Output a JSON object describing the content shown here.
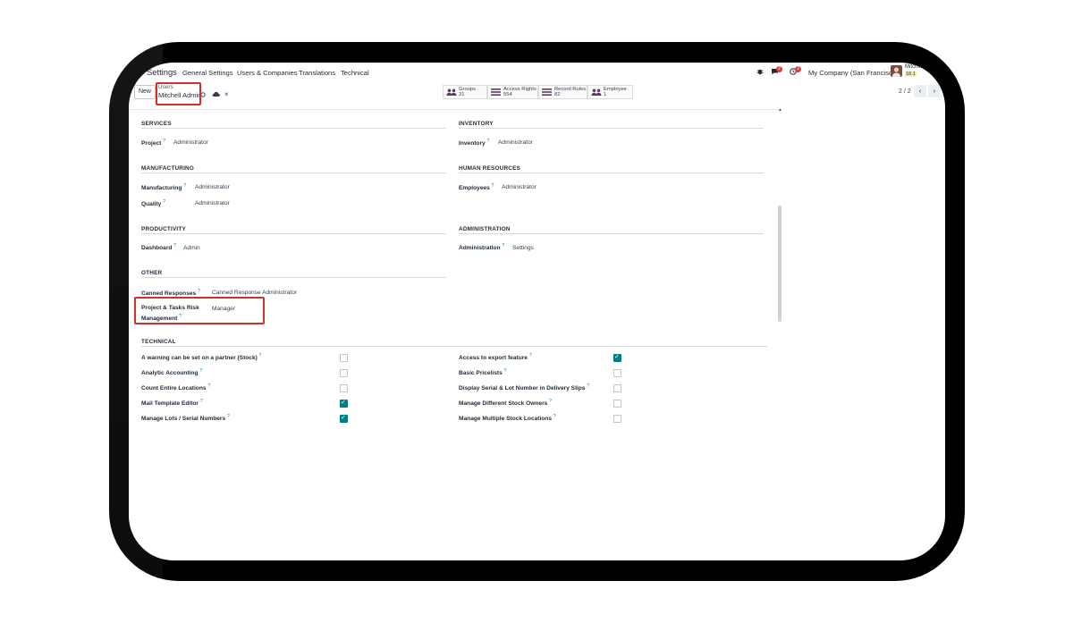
{
  "topnav": {
    "app_name": "Settings",
    "menu": [
      "General Settings",
      "Users & Companies",
      "Translations",
      "Technical"
    ],
    "company": "My Company (San Francisco)",
    "user_name": "Mitchell",
    "user_sub": "18.1",
    "chat_badge": "2",
    "activity_badge": "2"
  },
  "control": {
    "new_label": "New",
    "breadcrumb_parent": "Users",
    "breadcrumb_current": "Mitchell Admin",
    "stats": [
      {
        "label": "Groups",
        "count": "31"
      },
      {
        "label": "Access Rights",
        "count": "554"
      },
      {
        "label": "Record Rules",
        "count": "82"
      },
      {
        "label": "Employee",
        "count": "1"
      }
    ],
    "pager": "2 / 2"
  },
  "form": {
    "services": {
      "title": "SERVICES",
      "project_label": "Project",
      "project_value": "Administrator"
    },
    "inventory": {
      "title": "INVENTORY",
      "inventory_label": "Inventory",
      "inventory_value": "Administrator"
    },
    "manufacturing": {
      "title": "MANUFACTURING",
      "manufacturing_label": "Manufacturing",
      "manufacturing_value": "Administrator",
      "quality_label": "Quality",
      "quality_value": "Administrator"
    },
    "hr": {
      "title": "HUMAN RESOURCES",
      "employees_label": "Employees",
      "employees_value": "Administrator"
    },
    "productivity": {
      "title": "PRODUCTIVITY",
      "dashboard_label": "Dashboard",
      "dashboard_value": "Admin"
    },
    "administration": {
      "title": "ADMINISTRATION",
      "admin_label": "Administration",
      "admin_value": "Settings"
    },
    "other": {
      "title": "OTHER",
      "canned_label": "Canned Responses",
      "canned_value": "Canned Response Administrator",
      "risk_label_1": "Project & Tasks Risk",
      "risk_label_2": "Management",
      "risk_value": "Manager"
    },
    "technical": {
      "title": "TECHNICAL",
      "left": [
        {
          "label": "A warning can be set on a partner (Stock)",
          "checked": false
        },
        {
          "label": "Analytic Accounting",
          "checked": false
        },
        {
          "label": "Count Entire Locations",
          "checked": false
        },
        {
          "label": "Mail Template Editor",
          "checked": true
        },
        {
          "label": "Manage Lots / Serial Numbers",
          "checked": true
        }
      ],
      "right": [
        {
          "label": "Access to export feature",
          "checked": true
        },
        {
          "label": "Basic Pricelists",
          "checked": false
        },
        {
          "label": "Display Serial & Lot Number in Delivery Slips",
          "checked": false
        },
        {
          "label": "Manage Different Stock Owners",
          "checked": false
        },
        {
          "label": "Manage Multiple Stock Locations",
          "checked": false
        }
      ]
    },
    "help_mark": "?"
  },
  "colors": {
    "accent": "#017e84",
    "highlight": "#d0312d",
    "badge": "#d23f3a"
  }
}
